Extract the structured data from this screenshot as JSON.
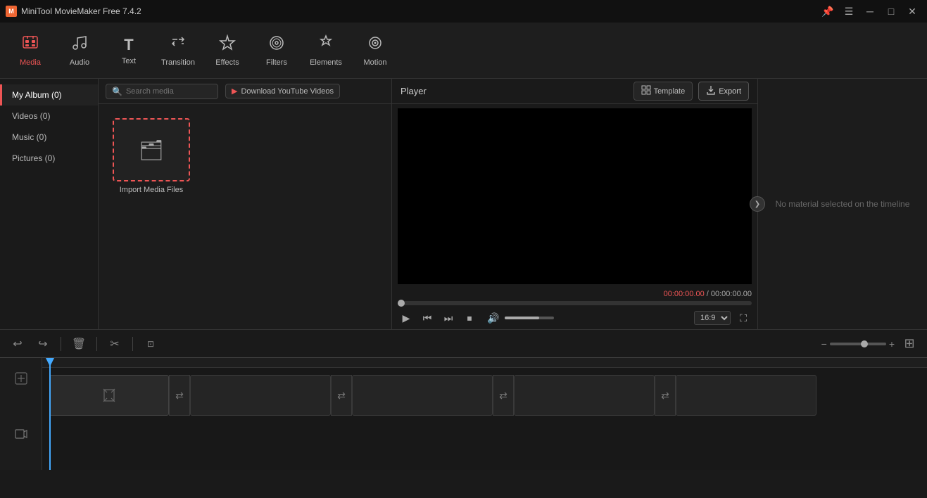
{
  "app": {
    "title": "MiniTool MovieMaker Free 7.4.2",
    "icon": "M"
  },
  "titlebar": {
    "pin_icon": "📌",
    "minimize_icon": "—",
    "maximize_icon": "□",
    "close_icon": "✕"
  },
  "toolbar": {
    "items": [
      {
        "id": "media",
        "label": "Media",
        "icon": "📁",
        "active": true
      },
      {
        "id": "audio",
        "label": "Audio",
        "icon": "♪"
      },
      {
        "id": "text",
        "label": "Text",
        "icon": "T"
      },
      {
        "id": "transition",
        "label": "Transition",
        "icon": "⇄"
      },
      {
        "id": "effects",
        "label": "Effects",
        "icon": "⬡"
      },
      {
        "id": "filters",
        "label": "Filters",
        "icon": "⊛"
      },
      {
        "id": "elements",
        "label": "Elements",
        "icon": "✦"
      },
      {
        "id": "motion",
        "label": "Motion",
        "icon": "◎"
      }
    ]
  },
  "sidebar": {
    "items": [
      {
        "id": "album",
        "label": "My Album (0)",
        "active": true
      },
      {
        "id": "videos",
        "label": "Videos (0)"
      },
      {
        "id": "music",
        "label": "Music (0)"
      },
      {
        "id": "pictures",
        "label": "Pictures (0)"
      }
    ]
  },
  "media_toolbar": {
    "search_placeholder": "Search media",
    "yt_label": "Download YouTube Videos",
    "yt_icon": "▶"
  },
  "import": {
    "label": "Import Media Files",
    "icon": "🗂"
  },
  "player": {
    "label": "Player",
    "template_label": "Template",
    "export_label": "Export",
    "current_time": "00:00:00.00",
    "total_time": "00:00:00.00",
    "aspect_ratio": "16:9"
  },
  "controls": {
    "play": "▶",
    "prev": "⏮",
    "next": "⏭",
    "stop": "⏹",
    "volume": "🔊",
    "fullscreen": "⛶"
  },
  "right_panel": {
    "no_material_text": "No material selected on the timeline",
    "collapse_icon": "❯"
  },
  "bottom_toolbar": {
    "undo_icon": "↩",
    "redo_icon": "↪",
    "delete_icon": "🗑",
    "cut_icon": "✂",
    "crop_icon": "⊡",
    "zoom_in_icon": "+",
    "zoom_out_icon": "−",
    "split_icon": "⊞"
  },
  "timeline": {
    "video_track_icon": "🎬",
    "audio_track_icon": "🎵",
    "add_media_icon": "⬇",
    "transition_icons": [
      "⇄",
      "⇄",
      "⇄",
      "⇄"
    ]
  }
}
